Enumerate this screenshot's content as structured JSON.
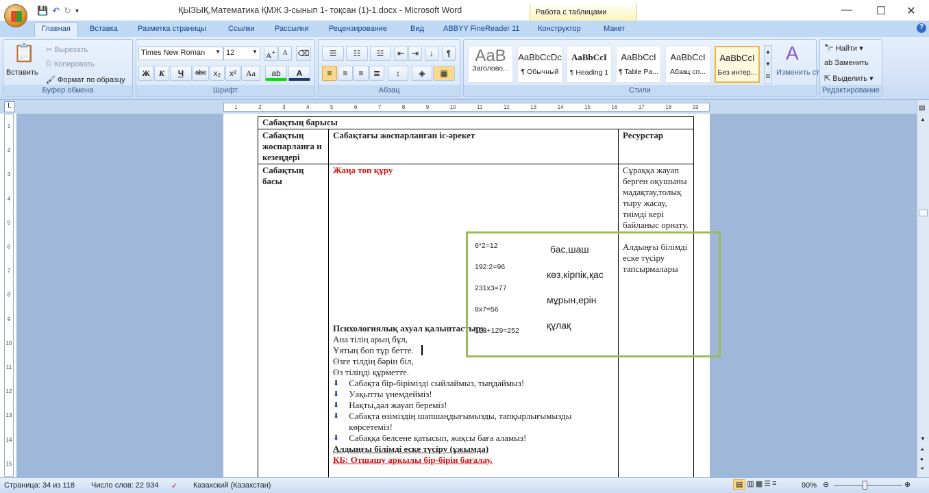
{
  "window": {
    "title": "ҚЫЗЫҚ,Математика  ҚМЖ 3-сынып 1- тоқсан (1)-1.docx - Microsoft Word",
    "context_tab": "Работа с таблицами",
    "min": "—",
    "max": "☐",
    "close": "✕"
  },
  "tabs": [
    "Главная",
    "Вставка",
    "Разметка страницы",
    "Ссылки",
    "Рассылки",
    "Рецензирование",
    "Вид",
    "ABBYY FineReader 11",
    "Конструктор",
    "Макет"
  ],
  "clipboard": {
    "paste": "Вставить",
    "cut": "Вырезать",
    "copy": "Копировать",
    "format": "Формат по образцу",
    "label": "Буфер обмена"
  },
  "font": {
    "name": "Times New Roman",
    "size": "12",
    "label": "Шрифт",
    "bold": "Ж",
    "italic": "К",
    "underline": "Ч",
    "strike": "abc",
    "sub": "x₂",
    "sup": "x²",
    "case": "Aa"
  },
  "paragraph": {
    "label": "Абзац"
  },
  "styles": {
    "label": "Стили",
    "items": [
      {
        "sample": "AaB",
        "name": "Заголово..."
      },
      {
        "sample": "AaBbCcDc",
        "name": "¶ Обычный"
      },
      {
        "sample": "AaBbCcI",
        "name": "¶ Heading 1"
      },
      {
        "sample": "AaBbCcI",
        "name": "¶ Table Pa..."
      },
      {
        "sample": "AaBbCcI",
        "name": "Абзац сп..."
      },
      {
        "sample": "AaBbCcI",
        "name": "Без интер..."
      }
    ],
    "change": "Изменить стили"
  },
  "editing": {
    "find": "Найти",
    "replace": "Заменить",
    "select": "Выделить",
    "label": "Редактирование"
  },
  "ruler": [
    "1",
    "2",
    "3",
    "4",
    "5",
    "6",
    "7",
    "8",
    "9",
    "10",
    "11",
    "12",
    "13",
    "14",
    "15",
    "16",
    "17",
    "18",
    "19"
  ],
  "vruler": [
    "1",
    "2",
    "3",
    "4",
    "5",
    "6",
    "7",
    "8",
    "9",
    "10",
    "11",
    "12",
    "13",
    "14",
    "15"
  ],
  "doc": {
    "section": "Сабақтың барысы",
    "headers": [
      "Сабақтың жоспарланға н кезеңдері",
      "Сабақтағы жоспарланған іс-әрекет",
      "Ресурстар"
    ],
    "stage": "Сабақтың басы",
    "activity_title": "Жаңа топ құру",
    "equations": [
      "6*2=12",
      "192:2=96",
      "231x3=77",
      "8x7=56",
      "123+129=252"
    ],
    "words": [
      "бас,шаш",
      "көз,кірпік,қас",
      "мұрын,ерін",
      "құлақ"
    ],
    "psych_title": "Психологиялық ахуал қалыптастыру.",
    "poem": [
      "Ана тілің арың бұл,",
      "Ұятың боп тұр бетте.",
      "Өзге тілдің бәрін біл,",
      "Өз тіліңді құрметте."
    ],
    "bullets": [
      "Сабақта бір-бірімізді сыйлаймыз, тыңдаймыз!",
      "Уақытты үнемдейміз!",
      "Нақты,дәл жауап береміз!",
      "Сабақта өзіміздің шапшаңдығымызды, тапқырлығымызды көрсетеміз!",
      "Сабаққа белсене қатысып, жақсы баға аламыз!"
    ],
    "recall": "Алдыңғы білімді еске түсіру (ұжымда)",
    "kb": "ҚБ: Отшашу  арқылы бір-бірін бағалау.",
    "resources_1": "Сұраққа жауап берген оқушыны мадақтау,толық тыру жасау, тиімді кері байланыс орнату.",
    "resources_2": "Алдыңғы білімді еске түсіру тапсырмалары"
  },
  "status": {
    "page": "Страница: 34 из 118",
    "words": "Число слов: 22 934",
    "lang": "Казахский (Казахстан)",
    "zoom": "90%"
  },
  "colors": {
    "accent": "#d01010",
    "green_border": "#9bbb59"
  }
}
